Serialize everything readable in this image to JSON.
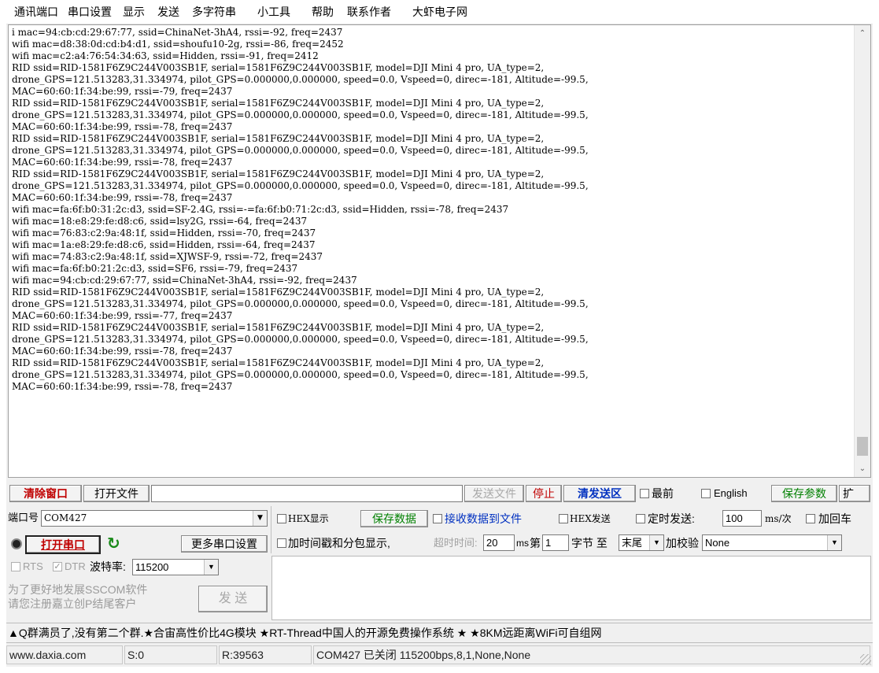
{
  "menu": [
    "通讯端口",
    "串口设置",
    "显示",
    "发送",
    "多字符串",
    "小工具",
    "帮助",
    "联系作者",
    "大虾电子网"
  ],
  "receive_lines": [
    "i mac=94:cb:cd:29:67:77, ssid=ChinaNet-3hA4, rssi=-92, freq=2437",
    "wifi mac=d8:38:0d:cd:b4:d1, ssid=shoufu10-2g, rssi=-86, freq=2452",
    "wifi mac=c2:a4:76:54:34:63, ssid=Hidden, rssi=-91, freq=2412",
    "RID ssid=RID-1581F6Z9C244V003SB1F, serial=1581F6Z9C244V003SB1F, model=DJI Mini 4 pro, UA_type=2,",
    "drone_GPS=121.513283,31.334974, pilot_GPS=0.000000,0.000000, speed=0.0, Vspeed=0, direc=-181, Altitude=-99.5,",
    "MAC=60:60:1f:34:be:99, rssi=-79, freq=2437",
    "RID ssid=RID-1581F6Z9C244V003SB1F, serial=1581F6Z9C244V003SB1F, model=DJI Mini 4 pro, UA_type=2,",
    "drone_GPS=121.513283,31.334974, pilot_GPS=0.000000,0.000000, speed=0.0, Vspeed=0, direc=-181, Altitude=-99.5,",
    "MAC=60:60:1f:34:be:99, rssi=-78, freq=2437",
    "RID ssid=RID-1581F6Z9C244V003SB1F, serial=1581F6Z9C244V003SB1F, model=DJI Mini 4 pro, UA_type=2,",
    "drone_GPS=121.513283,31.334974, pilot_GPS=0.000000,0.000000, speed=0.0, Vspeed=0, direc=-181, Altitude=-99.5,",
    "MAC=60:60:1f:34:be:99, rssi=-78, freq=2437",
    "RID ssid=RID-1581F6Z9C244V003SB1F, serial=1581F6Z9C244V003SB1F, model=DJI Mini 4 pro, UA_type=2,",
    "drone_GPS=121.513283,31.334974, pilot_GPS=0.000000,0.000000, speed=0.0, Vspeed=0, direc=-181, Altitude=-99.5,",
    "MAC=60:60:1f:34:be:99, rssi=-78, freq=2437",
    "wifi mac=fa:6f:b0:31:2c:d3, ssid=SF-2.4G, rssi=-=fa:6f:b0:71:2c:d3, ssid=Hidden, rssi=-78, freq=2437",
    "wifi mac=18:e8:29:fe:d8:c6, ssid=lsy2G, rssi=-64, freq=2437",
    "wifi mac=76:83:c2:9a:48:1f, ssid=Hidden, rssi=-70, freq=2437",
    "wifi mac=1a:e8:29:fe:d8:c6, ssid=Hidden, rssi=-64, freq=2437",
    "wifi mac=74:83:c2:9a:48:1f, ssid=XJWSF-9, rssi=-72, freq=2437",
    "wifi mac=fa:6f:b0:21:2c:d3, ssid=SF6, rssi=-79, freq=2437",
    "wifi mac=94:cb:cd:29:67:77, ssid=ChinaNet-3hA4, rssi=-92, freq=2437",
    "RID ssid=RID-1581F6Z9C244V003SB1F, serial=1581F6Z9C244V003SB1F, model=DJI Mini 4 pro, UA_type=2,",
    "drone_GPS=121.513283,31.334974, pilot_GPS=0.000000,0.000000, speed=0.0, Vspeed=0, direc=-181, Altitude=-99.5,",
    "MAC=60:60:1f:34:be:99, rssi=-77, freq=2437",
    "RID ssid=RID-1581F6Z9C244V003SB1F, serial=1581F6Z9C244V003SB1F, model=DJI Mini 4 pro, UA_type=2,",
    "drone_GPS=121.513283,31.334974, pilot_GPS=0.000000,0.000000, speed=0.0, Vspeed=0, direc=-181, Altitude=-99.5,",
    "MAC=60:60:1f:34:be:99, rssi=-78, freq=2437",
    "RID ssid=RID-1581F6Z9C244V003SB1F, serial=1581F6Z9C244V003SB1F, model=DJI Mini 4 pro, UA_type=2,",
    "drone_GPS=121.513283,31.334974, pilot_GPS=0.000000,0.000000, speed=0.0, Vspeed=0, direc=-181, Altitude=-99.5,",
    "MAC=60:60:1f:34:be:99, rssi=-78, freq=2437"
  ],
  "toolbar": {
    "clear": "清除窗口",
    "open_file": "打开文件",
    "file_path": "",
    "send_file": "发送文件",
    "stop": "停止",
    "clear_send": "清发送区",
    "topmost": "最前",
    "english": "English",
    "save_params": "保存参数",
    "expand": "扩"
  },
  "port": {
    "label": "端口号",
    "value": "COM427",
    "open_btn": "打开串口",
    "more_settings": "更多串口设置",
    "rts": "RTS",
    "dtr": "DTR",
    "baud_label": "波特率:",
    "baud_value": "115200",
    "promo_line1": "为了更好地发展SSCOM软件",
    "promo_line2": "请您注册嘉立创P结尾客户",
    "send_btn": "发 送"
  },
  "options": {
    "hex_display": "HEX显示",
    "save_data": "保存数据",
    "recv_to_file": "接收数据到文件",
    "hex_send": "HEX发送",
    "timed_send": "定时发送:",
    "interval": "100",
    "interval_unit": "ms/次",
    "add_crlf": "加回车",
    "timestamp": "加时间戳和分包显示,",
    "timeout_label": "超时时间:",
    "timeout_value": "20",
    "timeout_unit": "ms",
    "byte_prefix": "第",
    "byte_value": "1",
    "byte_mid": "字节 至",
    "byte_end": "末尾",
    "checksum_label": "加校验",
    "checksum_value": "None"
  },
  "send_text": "",
  "promo_bar": "▲Q群满员了,没有第二个群.★合宙高性价比4G模块 ★RT-Thread中国人的开源免费操作系统 ★ ★8KM远距离WiFi可自组网",
  "statusbar": {
    "site": "www.daxia.com",
    "sent": "S:0",
    "received": "R:39563",
    "port_status": "COM427 已关闭  115200bps,8,1,None,None"
  }
}
